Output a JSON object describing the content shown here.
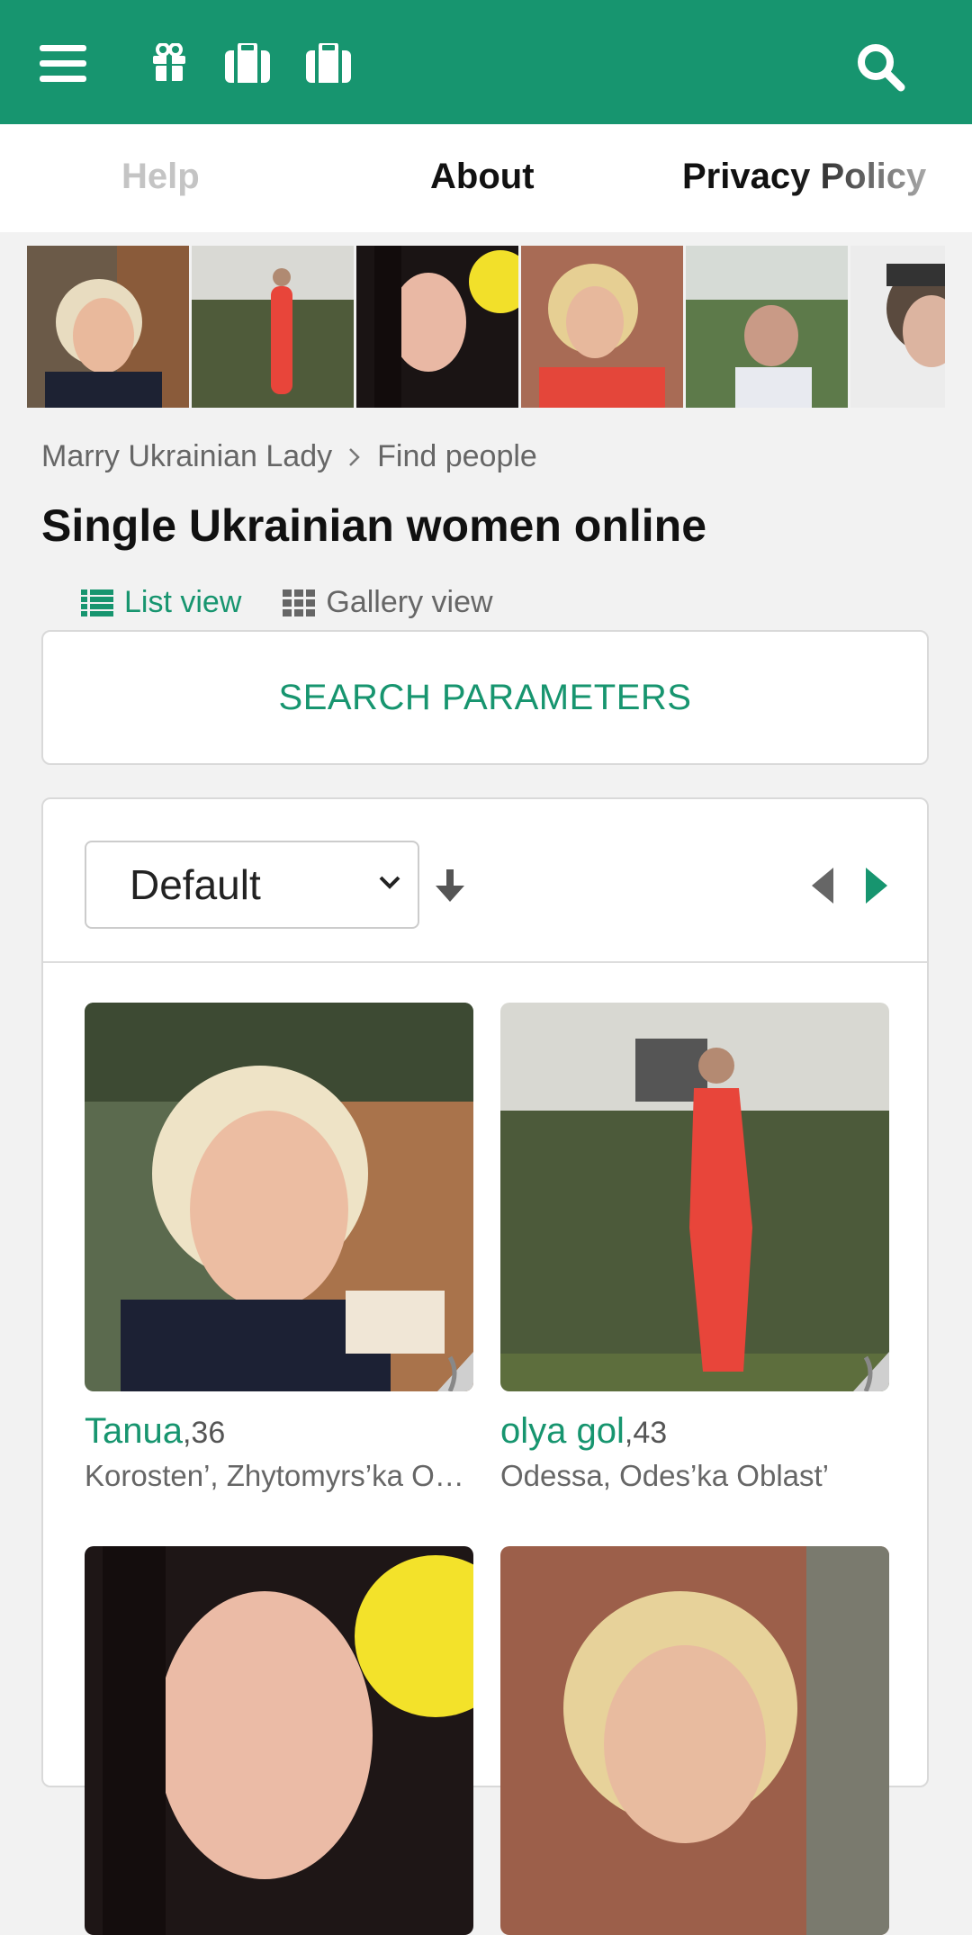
{
  "header": {
    "icons": [
      "menu-icon",
      "gift-icon",
      "briefcase-icon",
      "briefcase-icon",
      "search-icon"
    ],
    "brand_color": "#17956f"
  },
  "nav": {
    "help": "Help",
    "about": "About",
    "privacy": "Privacy Policy"
  },
  "breadcrumb": {
    "home": "Marry Ukrainian Lady",
    "current": "Find people"
  },
  "page": {
    "title": "Single Ukrainian women online"
  },
  "views": {
    "list": "List view",
    "gallery": "Gallery view"
  },
  "search": {
    "label": "SEARCH PARAMETERS"
  },
  "sort": {
    "selected": "Default"
  },
  "profiles": [
    {
      "name": "Tanua",
      "age": ",36",
      "location": "Korosten’, Zhytomyrs’ka Oblast’"
    },
    {
      "name": "olya gol",
      "age": ",43",
      "location": "Odessa, Odes’ka Oblast’"
    }
  ]
}
